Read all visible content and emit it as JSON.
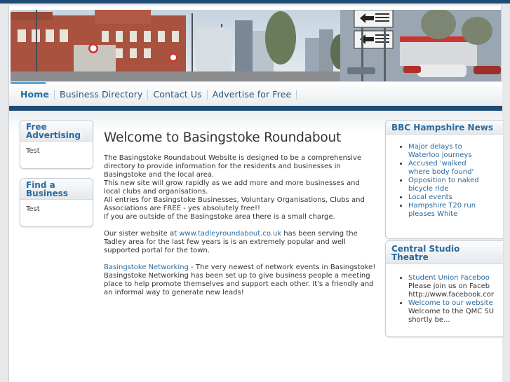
{
  "colors": {
    "accent": "#2a6a9e",
    "nav_dark": "#1d4b73",
    "active_bar": "#5ea7d6"
  },
  "nav": {
    "items": [
      {
        "label": "Home",
        "active": true
      },
      {
        "label": "Business Directory",
        "active": false
      },
      {
        "label": "Contact Us",
        "active": false
      },
      {
        "label": "Advertise for Free",
        "active": false
      }
    ]
  },
  "left_sidebar": {
    "free_advertising": {
      "title_line1": "Free",
      "title_line2": "Advertising",
      "body": "Test"
    },
    "find_business": {
      "title_line1": "Find a",
      "title_line2": "Business",
      "body": "Test"
    }
  },
  "main": {
    "heading": "Welcome to Basingstoke Roundabout",
    "p1": "The Basingstoke Roundabout Website is designed to be a comprehensive directory to provide information for the residents and businesses in Basingstoke and the local area.",
    "p1b": "This new site will grow rapidly as we add more and more businesses and local clubs and organisations.",
    "p1c": "All entries for Basingstoke Businesses, Voluntary Organisations, Clubs and Associations are FREE - yes absolutely free!!",
    "p1d": "If you are outside of the Basingstoke area there is a small charge.",
    "p2_prefix": "Our sister website at ",
    "p2_link": "www.tadleyroundabout.co.uk",
    "p2_suffix": " has been serving the Tadley area for the last few years is is an extremely popular and well supported portal for the town.",
    "p3_link": "Basingstoke Networking",
    "p3_suffix": " - The very newest of network events in Basingstoke! Basingstoke Networking has been set up to give business people a meeting place to help promote themselves and support each other. It's a friendly and an informal way to generate new leads!"
  },
  "right_sidebar": {
    "bbc": {
      "title": "BBC Hampshire News",
      "items": [
        {
          "line1": "Major delays to",
          "line2": "Waterloo journeys"
        },
        {
          "line1": "Accused 'walked",
          "line2": "where body found'"
        },
        {
          "line1": "Opposition to naked",
          "line2": "bicycle ride"
        },
        {
          "line1": "Local events",
          "line2": ""
        },
        {
          "line1": "Hampshire T20 run",
          "line2": "pleases White"
        }
      ]
    },
    "theatre": {
      "title_line1": "Central Studio",
      "title_line2": "Theatre",
      "items": [
        {
          "link": "Student Union Faceboo",
          "text": [
            "Please join us on Faceb",
            "http://www.facebook.cor"
          ]
        },
        {
          "link": "Welcome to our website",
          "text": [
            "Welcome to the QMC SU",
            "shortly be..."
          ]
        }
      ]
    }
  }
}
